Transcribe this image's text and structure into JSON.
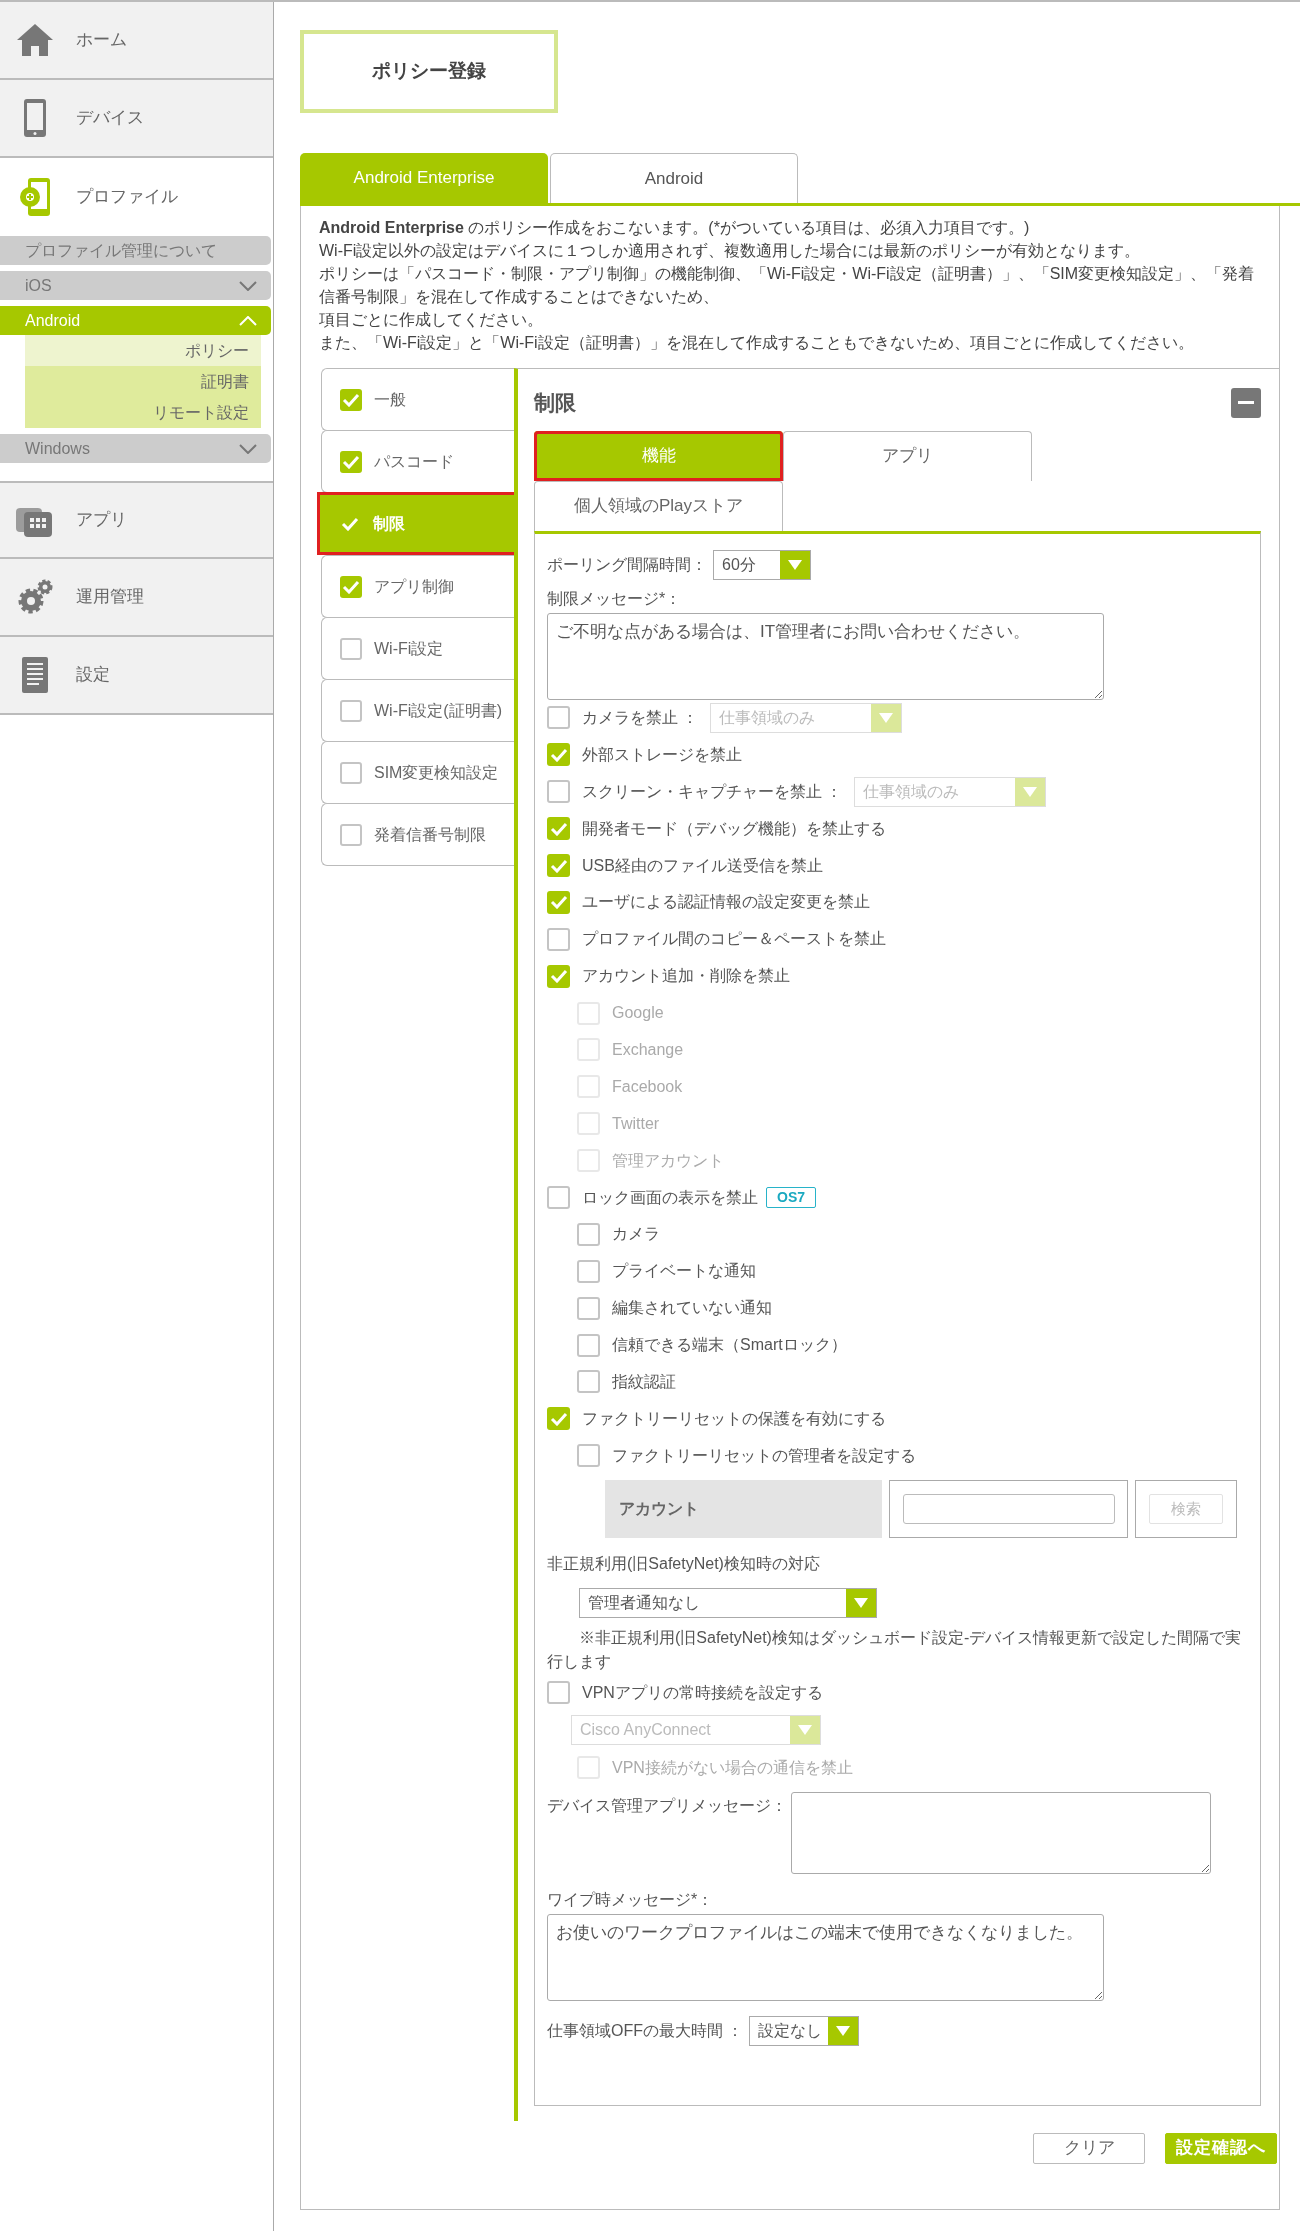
{
  "sidebar": {
    "nav": [
      {
        "label": "ホーム",
        "selected": false
      },
      {
        "label": "デバイス",
        "selected": false
      },
      {
        "label": "プロファイル",
        "selected": true
      },
      {
        "label": "アプリ",
        "selected": false
      },
      {
        "label": "運用管理",
        "selected": false
      },
      {
        "label": "設定",
        "selected": false
      }
    ],
    "submenu": [
      {
        "label": "プロファイル管理について",
        "kind": "link"
      },
      {
        "label": "iOS",
        "kind": "group",
        "expanded": false
      },
      {
        "label": "Android",
        "kind": "group",
        "expanded": true,
        "children": [
          {
            "label": "ポリシー",
            "selected": true
          },
          {
            "label": "証明書",
            "selected": false
          },
          {
            "label": "リモート設定",
            "selected": false
          }
        ]
      },
      {
        "label": "Windows",
        "kind": "group",
        "expanded": false
      }
    ]
  },
  "page_title": "ポリシー登録",
  "platform_tabs": [
    {
      "label": "Android Enterprise",
      "selected": true
    },
    {
      "label": "Android",
      "selected": false
    }
  ],
  "description": [
    "**Android Enterprise** のポリシー作成をおこないます。(*がついている項目は、必須入力項目です。)",
    "Wi-Fi設定以外の設定はデバイスに１つしか適用されず、複数適用した場合には最新のポリシーが有効となります。",
    "ポリシーは「パスコード・制限・アプリ制御」の機能制御、「Wi-Fi設定・Wi-Fi設定（証明書）」、「SIM変更検知設定」、「発着信番号制限」を混在して作成することはできないため、",
    "項目ごとに作成してください。",
    "また、「Wi-Fi設定」と「Wi-Fi設定（証明書）」を混在して作成することもできないため、項目ごとに作成してください。"
  ],
  "policy_categories": [
    {
      "label": "一般",
      "checked": true,
      "selected": false
    },
    {
      "label": "パスコード",
      "checked": true,
      "selected": false
    },
    {
      "label": "制限",
      "checked": true,
      "selected": true
    },
    {
      "label": "アプリ制御",
      "checked": true,
      "selected": false
    },
    {
      "label": "Wi-Fi設定",
      "checked": false,
      "selected": false
    },
    {
      "label": "Wi-Fi設定(証明書)",
      "checked": false,
      "selected": false
    },
    {
      "label": "SIM変更検知設定",
      "checked": false,
      "selected": false
    },
    {
      "label": "発着信番号制限",
      "checked": false,
      "selected": false
    }
  ],
  "section": {
    "title": "制限",
    "tabs": [
      {
        "label": "機能",
        "selected": true
      },
      {
        "label": "アプリ",
        "selected": false
      },
      {
        "label": "個人領域のPlayストア",
        "selected": false
      }
    ],
    "form": [
      {
        "kind": "select",
        "label": "ポーリング間隔時間：",
        "value": "60分"
      },
      {
        "kind": "textarea",
        "label": "制限メッセージ*：",
        "value": "ご不明な点がある場合は、IT管理者にお問い合わせください。"
      },
      {
        "kind": "checkbox",
        "label": "カメラを禁止 ：",
        "checked": false,
        "disabled": false,
        "select": {
          "value": "仕事領域のみ",
          "disabled": true
        }
      },
      {
        "kind": "checkbox",
        "label": "外部ストレージを禁止",
        "checked": true,
        "disabled": false
      },
      {
        "kind": "checkbox",
        "label": "スクリーン・キャプチャーを禁止 ：",
        "checked": false,
        "disabled": false,
        "select": {
          "value": "仕事領域のみ",
          "disabled": true
        }
      },
      {
        "kind": "checkbox",
        "label": "開発者モード（デバッグ機能）を禁止する",
        "checked": true,
        "disabled": false
      },
      {
        "kind": "checkbox",
        "label": "USB経由のファイル送受信を禁止",
        "checked": true,
        "disabled": false
      },
      {
        "kind": "checkbox",
        "label": "ユーザによる認証情報の設定変更を禁止",
        "checked": true,
        "disabled": false
      },
      {
        "kind": "checkbox",
        "label": "プロファイル間のコピー＆ペーストを禁止",
        "checked": false,
        "disabled": false
      },
      {
        "kind": "checkbox",
        "label": "アカウント追加・削除を禁止",
        "checked": true,
        "disabled": false,
        "children": [
          {
            "kind": "checkbox",
            "label": "Google",
            "checked": false,
            "disabled": true
          },
          {
            "kind": "checkbox",
            "label": "Exchange",
            "checked": false,
            "disabled": true
          },
          {
            "kind": "checkbox",
            "label": "Facebook",
            "checked": false,
            "disabled": true
          },
          {
            "kind": "checkbox",
            "label": "Twitter",
            "checked": false,
            "disabled": true
          },
          {
            "kind": "checkbox",
            "label": "管理アカウント",
            "checked": false,
            "disabled": true
          }
        ]
      },
      {
        "kind": "checkbox",
        "label": "ロック画面の表示を禁止",
        "checked": false,
        "disabled": false,
        "badge": "OS7",
        "children": [
          {
            "kind": "checkbox",
            "label": "カメラ",
            "checked": false,
            "disabled": false
          },
          {
            "kind": "checkbox",
            "label": "プライベートな通知",
            "checked": false,
            "disabled": false
          },
          {
            "kind": "checkbox",
            "label": "編集されていない通知",
            "checked": false,
            "disabled": false
          },
          {
            "kind": "checkbox",
            "label": "信頼できる端末（Smartロック）",
            "checked": false,
            "disabled": false
          },
          {
            "kind": "checkbox",
            "label": "指紋認証",
            "checked": false,
            "disabled": false
          }
        ]
      },
      {
        "kind": "checkbox",
        "label": "ファクトリーリセットの保護を有効にする",
        "checked": true,
        "disabled": false,
        "children": [
          {
            "kind": "checkbox",
            "label": "ファクトリーリセットの管理者を設定する",
            "checked": false,
            "disabled": false
          },
          {
            "kind": "account_search",
            "header": "アカウント",
            "button": "検索",
            "button_disabled": true
          }
        ]
      },
      {
        "kind": "select_block",
        "label": "非正規利用(旧SafetyNet)検知時の対応",
        "value": "管理者通知なし",
        "note": "※非正規利用(旧SafetyNet)検知はダッシュボード設定-デバイス情報更新で設定した間隔で実行します"
      },
      {
        "kind": "checkbox",
        "label": "VPNアプリの常時接続を設定する",
        "checked": false,
        "disabled": false,
        "children": [
          {
            "kind": "select",
            "value": "Cisco AnyConnect",
            "disabled": true
          },
          {
            "kind": "checkbox",
            "label": "VPN接続がない場合の通信を禁止",
            "checked": false,
            "disabled": true
          }
        ]
      },
      {
        "kind": "textarea_inline",
        "label": "デバイス管理アプリメッセージ："
      },
      {
        "kind": "textarea",
        "label": "ワイプ時メッセージ*：",
        "value": "お使いのワークプロファイルはこの端末で使用できなくなりました。"
      },
      {
        "kind": "select",
        "label": "仕事領域OFFの最大時間 ：",
        "value": "設定なし"
      }
    ]
  },
  "buttons": [
    {
      "label": "クリア",
      "kind": "secondary"
    },
    {
      "label": "設定確認へ",
      "kind": "primary"
    }
  ]
}
